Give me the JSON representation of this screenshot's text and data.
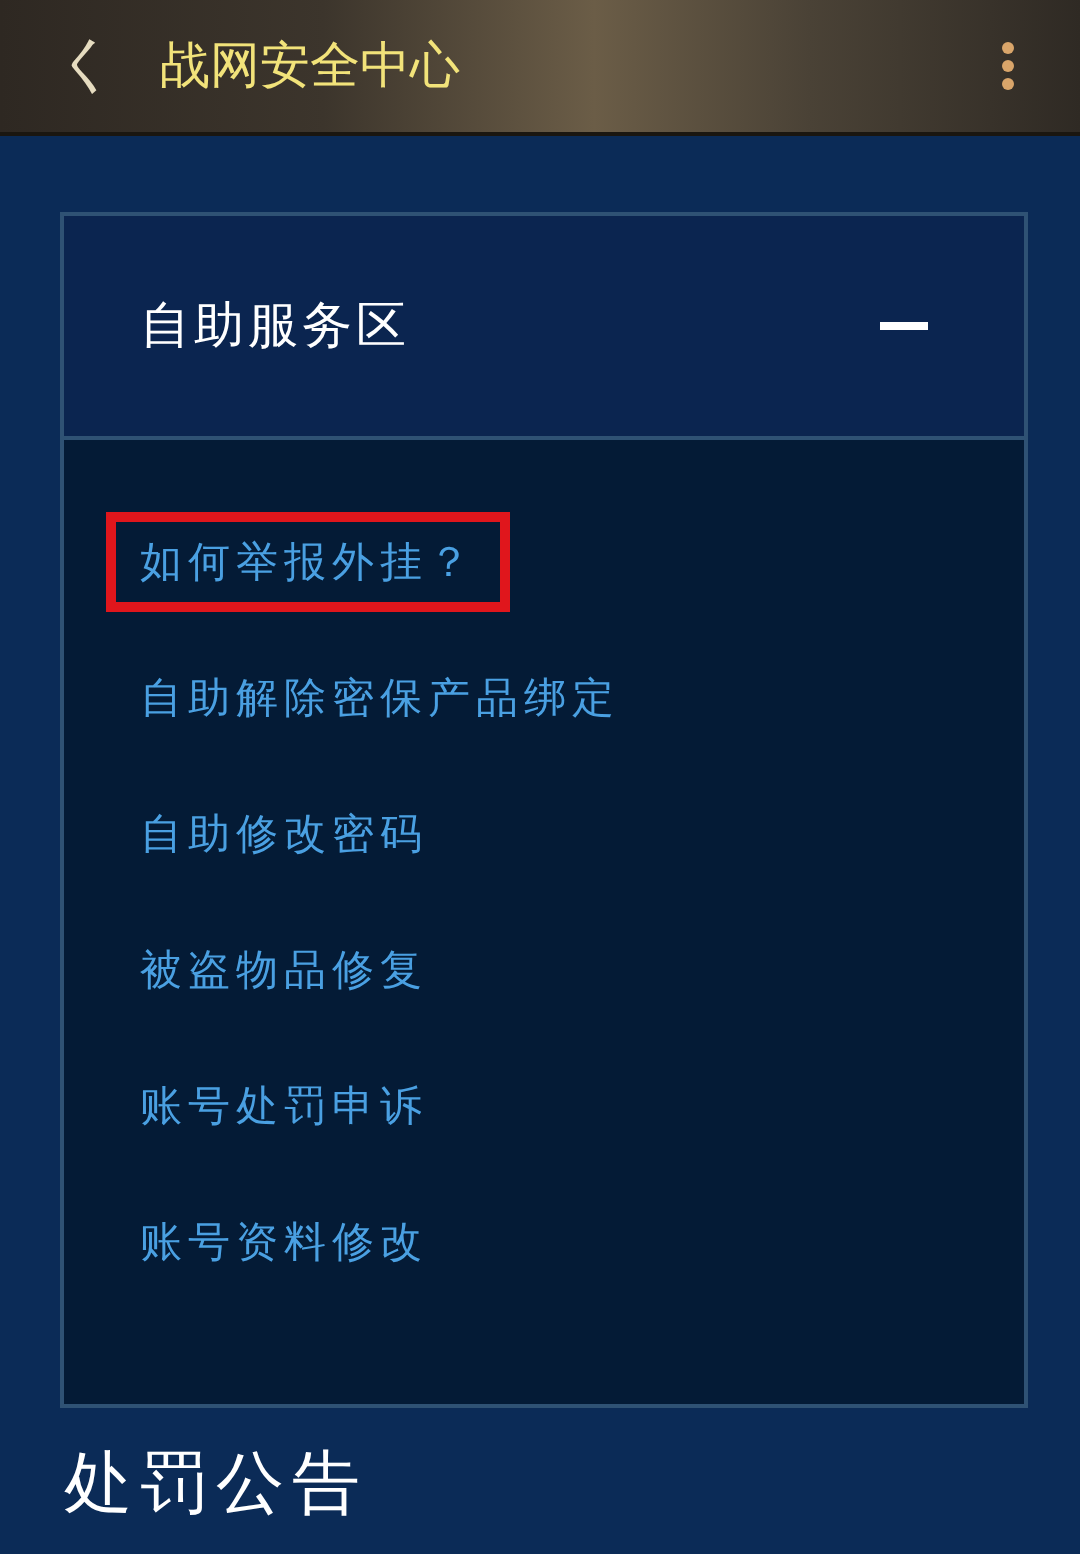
{
  "header": {
    "back": "く",
    "title": "战网安全中心"
  },
  "panel": {
    "title": "自助服务区",
    "expanded": true,
    "items": [
      {
        "label": "如何举报外挂？",
        "highlighted": true
      },
      {
        "label": "自助解除密保产品绑定",
        "highlighted": false
      },
      {
        "label": "自助修改密码",
        "highlighted": false
      },
      {
        "label": "被盗物品修复",
        "highlighted": false
      },
      {
        "label": "账号处罚申诉",
        "highlighted": false
      },
      {
        "label": "账号资料修改",
        "highlighted": false
      }
    ]
  },
  "section_title": "处罚公告"
}
